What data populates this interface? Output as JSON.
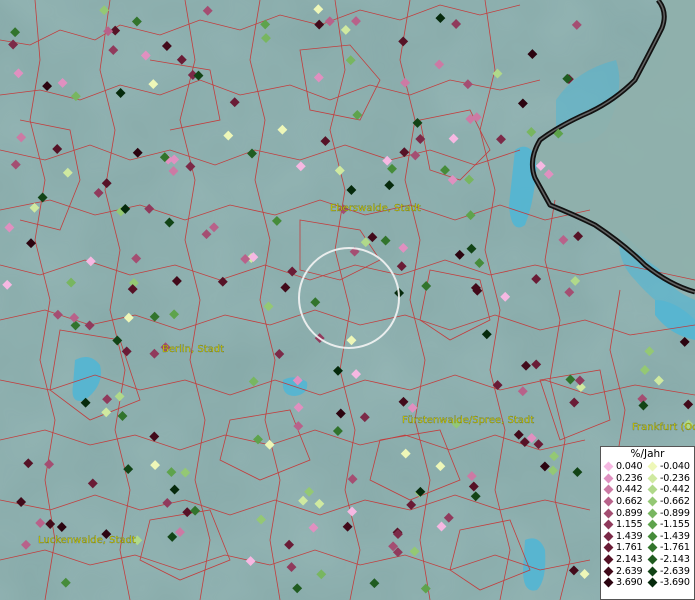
{
  "map": {
    "labels": {
      "eberswalde": "Eberswalde, Stadt",
      "berlin": "Berlin, Stadt",
      "fuerstenwalde": "Fürstenwalde/Spree, Stadt",
      "frankfurt": "Frankfurt (Oder)",
      "luckenwalde": "Luckenwalde, Stadt"
    }
  },
  "legend": {
    "title": "%/Jahr",
    "positive": [
      {
        "label": "0.040",
        "color": "#f6b8e2"
      },
      {
        "label": "0.236",
        "color": "#e090c0"
      },
      {
        "label": "0.442",
        "color": "#cc7aa4"
      },
      {
        "label": "0.662",
        "color": "#b8628a"
      },
      {
        "label": "0.899",
        "color": "#a44e72"
      },
      {
        "label": "1.155",
        "color": "#903a5c"
      },
      {
        "label": "1.439",
        "color": "#7c2a48"
      },
      {
        "label": "1.761",
        "color": "#6a1c36"
      },
      {
        "label": "2.143",
        "color": "#561226"
      },
      {
        "label": "2.639",
        "color": "#420a1a"
      },
      {
        "label": "3.690",
        "color": "#2c0410"
      }
    ],
    "negative": [
      {
        "label": "-0.040",
        "color": "#eef7b8"
      },
      {
        "label": "-0.236",
        "color": "#cfe9a0"
      },
      {
        "label": "-0.442",
        "color": "#b0d98a"
      },
      {
        "label": "-0.662",
        "color": "#94c874"
      },
      {
        "label": "-0.899",
        "color": "#78b660"
      },
      {
        "label": "-1.155",
        "color": "#5ea34c"
      },
      {
        "label": "-1.439",
        "color": "#468c3a"
      },
      {
        "label": "-1.761",
        "color": "#32742c"
      },
      {
        "label": "-2.143",
        "color": "#205c20"
      },
      {
        "label": "-2.639",
        "color": "#124416"
      },
      {
        "label": "-3.690",
        "color": "#062a0c"
      }
    ]
  }
}
